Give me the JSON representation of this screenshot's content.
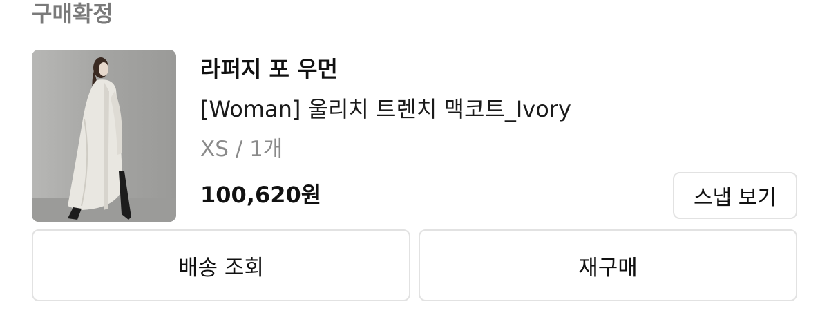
{
  "order": {
    "status": "구매확정"
  },
  "product": {
    "image_alt": "트렌치 맥코트를 입은 모델",
    "brand": "라퍼지 포 우먼",
    "name": "[Woman] 울리치 트렌치 맥코트_Ivory",
    "option": "XS / 1개",
    "price": "100,620원"
  },
  "actions": {
    "snap_label": "스냅 보기",
    "track_label": "배송 조회",
    "rebuy_label": "재구매"
  }
}
